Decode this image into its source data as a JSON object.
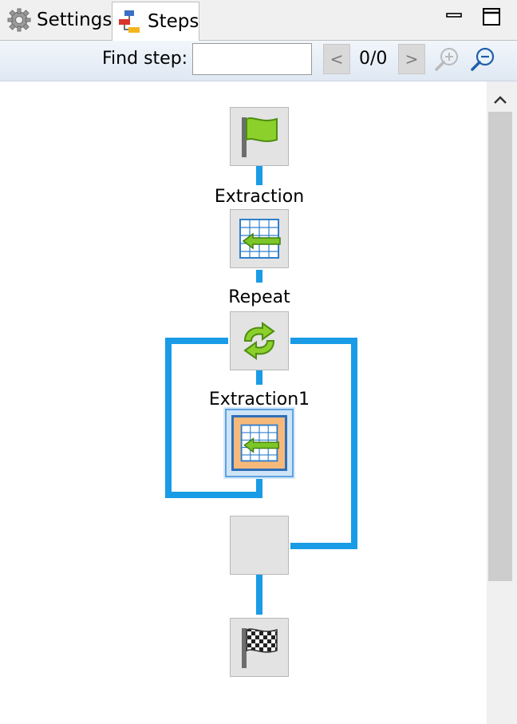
{
  "tabs": [
    {
      "label": "Settings",
      "icon": "gear-icon"
    },
    {
      "label": "Steps",
      "icon": "steps-icon"
    }
  ],
  "toolbar": {
    "find_label": "Find step:",
    "find_value": "",
    "prev_label": "<",
    "next_label": ">",
    "counter": "0/0"
  },
  "steps": [
    {
      "label": "",
      "icon": "green-flag-icon"
    },
    {
      "label": "Extraction",
      "icon": "extraction-icon"
    },
    {
      "label": "Repeat",
      "icon": "repeat-icon"
    },
    {
      "label": "Extraction1",
      "icon": "extraction-icon"
    },
    {
      "label": "",
      "icon": "blank"
    },
    {
      "label": "",
      "icon": "checkered-flag-icon"
    }
  ],
  "colors": {
    "connector": "#1a9be6",
    "node_bg": "#e3e3e3",
    "selected": "#5ea3e0",
    "toolbar_bg": "#dfe8f3"
  }
}
